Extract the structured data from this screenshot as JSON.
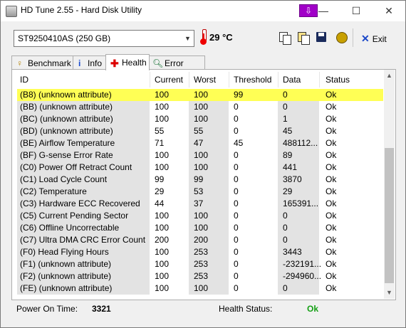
{
  "window": {
    "title": "HD Tune 2.55 - Hard Disk Utility",
    "buttons": {
      "minimize": "—",
      "maximize": "☐",
      "close": "✕"
    }
  },
  "toolbar": {
    "drive": "ST9250410AS (250 GB)",
    "temperature": "29 °C",
    "exit_label": "Exit"
  },
  "tabs": [
    {
      "label": "Benchmark",
      "icon": "lightbulb-icon"
    },
    {
      "label": "Info",
      "icon": "info-icon"
    },
    {
      "label": "Health",
      "icon": "plus-icon",
      "active": true
    },
    {
      "label": "Error Scan",
      "icon": "magnifier-icon"
    }
  ],
  "table": {
    "columns": [
      "ID",
      "Current",
      "Worst",
      "Threshold",
      "Data",
      "Status"
    ],
    "rows": [
      {
        "id": "(B8) (unknown attribute)",
        "current": "100",
        "worst": "100",
        "threshold": "99",
        "data": "0",
        "status": "Ok",
        "selected": true
      },
      {
        "id": "(BB) (unknown attribute)",
        "current": "100",
        "worst": "100",
        "threshold": "0",
        "data": "0",
        "status": "Ok"
      },
      {
        "id": "(BC) (unknown attribute)",
        "current": "100",
        "worst": "100",
        "threshold": "0",
        "data": "1",
        "status": "Ok"
      },
      {
        "id": "(BD) (unknown attribute)",
        "current": "55",
        "worst": "55",
        "threshold": "0",
        "data": "45",
        "status": "Ok"
      },
      {
        "id": "(BE) Airflow Temperature",
        "current": "71",
        "worst": "47",
        "threshold": "45",
        "data": "488112...",
        "status": "Ok"
      },
      {
        "id": "(BF) G-sense Error Rate",
        "current": "100",
        "worst": "100",
        "threshold": "0",
        "data": "89",
        "status": "Ok"
      },
      {
        "id": "(C0) Power Off Retract Count",
        "current": "100",
        "worst": "100",
        "threshold": "0",
        "data": "441",
        "status": "Ok"
      },
      {
        "id": "(C1) Load Cycle Count",
        "current": "99",
        "worst": "99",
        "threshold": "0",
        "data": "3870",
        "status": "Ok"
      },
      {
        "id": "(C2) Temperature",
        "current": "29",
        "worst": "53",
        "threshold": "0",
        "data": "29",
        "status": "Ok"
      },
      {
        "id": "(C3) Hardware ECC Recovered",
        "current": "44",
        "worst": "37",
        "threshold": "0",
        "data": "165391...",
        "status": "Ok"
      },
      {
        "id": "(C5) Current Pending Sector",
        "current": "100",
        "worst": "100",
        "threshold": "0",
        "data": "0",
        "status": "Ok"
      },
      {
        "id": "(C6) Offline Uncorrectable",
        "current": "100",
        "worst": "100",
        "threshold": "0",
        "data": "0",
        "status": "Ok"
      },
      {
        "id": "(C7) Ultra DMA CRC Error Count",
        "current": "200",
        "worst": "200",
        "threshold": "0",
        "data": "0",
        "status": "Ok"
      },
      {
        "id": "(F0) Head Flying Hours",
        "current": "100",
        "worst": "253",
        "threshold": "0",
        "data": "3443",
        "status": "Ok"
      },
      {
        "id": "(F1) (unknown attribute)",
        "current": "100",
        "worst": "253",
        "threshold": "0",
        "data": "-232191...",
        "status": "Ok"
      },
      {
        "id": "(F2) (unknown attribute)",
        "current": "100",
        "worst": "253",
        "threshold": "0",
        "data": "-294960...",
        "status": "Ok"
      },
      {
        "id": "(FE) (unknown attribute)",
        "current": "100",
        "worst": "100",
        "threshold": "0",
        "data": "0",
        "status": "Ok"
      }
    ]
  },
  "statusbar": {
    "power_on_label": "Power On Time:",
    "power_on_value": "3321",
    "health_label": "Health Status:",
    "health_value": "Ok"
  }
}
